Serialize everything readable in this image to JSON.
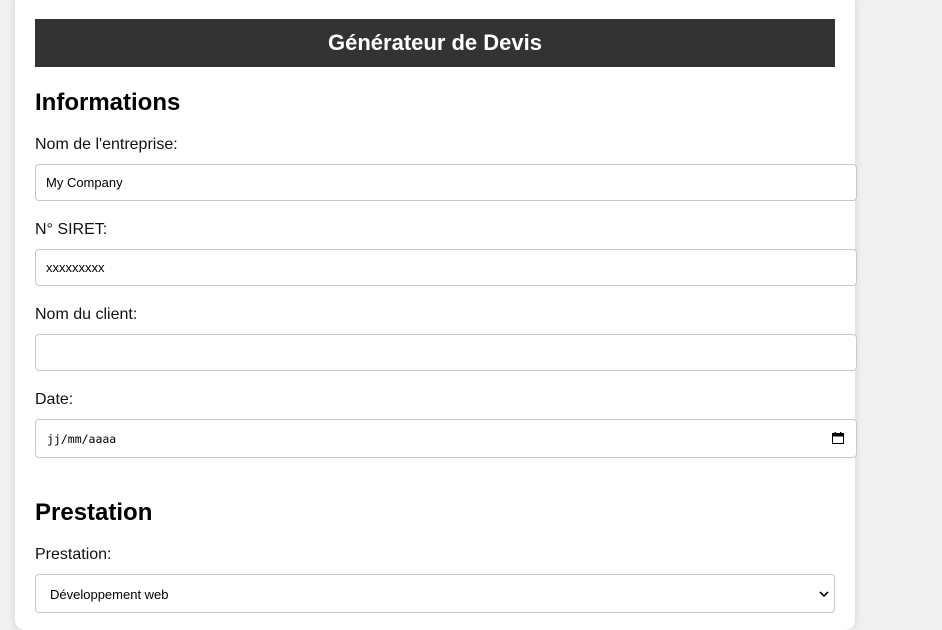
{
  "header": {
    "title": "Générateur de Devis"
  },
  "informations": {
    "title": "Informations",
    "company": {
      "label": "Nom de l'entreprise:",
      "value": "My Company"
    },
    "siret": {
      "label": "N° SIRET:",
      "value": "xxxxxxxxx"
    },
    "client": {
      "label": "Nom du client:",
      "value": ""
    },
    "date": {
      "label": "Date:",
      "value": "jj/mm/aaaa",
      "icon": "calendar-icon"
    }
  },
  "prestation": {
    "title": "Prestation",
    "label": "Prestation:",
    "selected": "Développement web",
    "icon": "chevron-down-icon"
  }
}
